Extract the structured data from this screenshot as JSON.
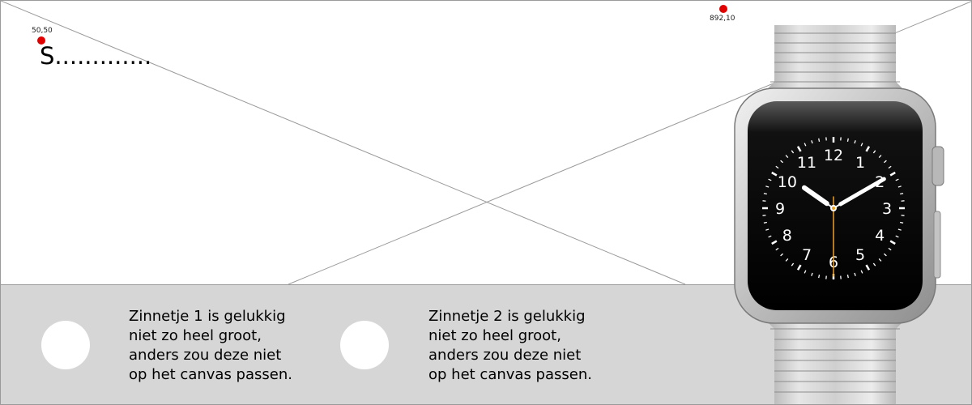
{
  "canvas": {
    "background": "#ffffff",
    "band_color": "#d6d6d6",
    "border_color": "#9a9a9a"
  },
  "markers": [
    {
      "label": "50,50",
      "color": "#e00000"
    },
    {
      "label": "892,10",
      "color": "#e00000"
    }
  ],
  "headline": {
    "text": "S............."
  },
  "sentences": [
    {
      "lines": [
        "Zinnetje 1 is gelukkig",
        "niet zo heel groot,",
        "anders zou deze niet",
        "op het canvas passen."
      ]
    },
    {
      "lines": [
        "Zinnetje 2 is gelukkig",
        "niet zo heel groot,",
        "anders zou deze niet",
        "op het canvas passen."
      ]
    }
  ],
  "watch": {
    "hour_numbers": [
      "12",
      "1",
      "2",
      "3",
      "4",
      "5",
      "6",
      "7",
      "8",
      "9",
      "10",
      "11"
    ],
    "band_color": "#c9c9c9",
    "case_color": "#d0d0d0",
    "screen_color": "#000000",
    "second_hand_color": "#f0a020"
  }
}
